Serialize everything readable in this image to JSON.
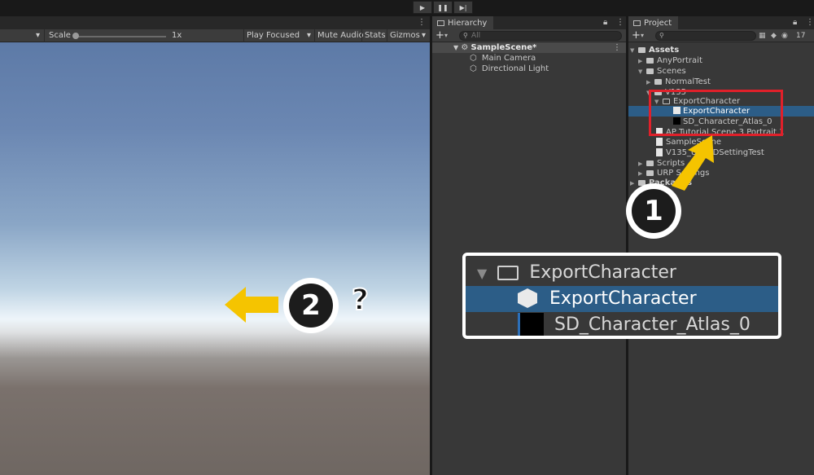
{
  "toolbar": {
    "play": "▶",
    "pause": "❚❚",
    "step": "▶|"
  },
  "game": {
    "tabmenu": "⋮",
    "display_caret": "▾",
    "scale_label": "Scale",
    "scale_value": "1x",
    "play_mode": "Play Focused",
    "mute_audio": "Mute Audio",
    "stats": "Stats",
    "gizmos": "Gizmos",
    "sky_color_top": "#5d7aa7",
    "ground_color": "#6f6762"
  },
  "hierarchy": {
    "title": "Hierarchy",
    "search_placeholder": "All",
    "items": [
      {
        "label": "SampleScene*"
      },
      {
        "label": "Main Camera"
      },
      {
        "label": "Directional Light"
      }
    ]
  },
  "project": {
    "title": "Project",
    "badge_count": "17",
    "items": [
      {
        "label": "Assets"
      },
      {
        "label": "AnyPortrait"
      },
      {
        "label": "Scenes"
      },
      {
        "label": "NormalTest"
      },
      {
        "label": "V135"
      },
      {
        "label": "ExportCharacter"
      },
      {
        "label": "ExportCharacter"
      },
      {
        "label": "SD_Character_Atlas_0"
      },
      {
        "label": "AP Tutorial Scene 3 Portrait 1"
      },
      {
        "label": "SampleScene"
      },
      {
        "label": "V135_URP2DSettingTest"
      },
      {
        "label": "Scripts"
      },
      {
        "label": "URP Settings"
      },
      {
        "label": "Packages"
      }
    ]
  },
  "zoom": {
    "folder": "ExportCharacter",
    "prefab": "ExportCharacter",
    "atlas": "SD_Character_Atlas_0"
  },
  "annotations": {
    "step1": "1",
    "step2": "2",
    "question": "?",
    "arrow_color": "#f5c400",
    "highlight_color": "#e0202a",
    "selection_color": "#2c5d87"
  }
}
